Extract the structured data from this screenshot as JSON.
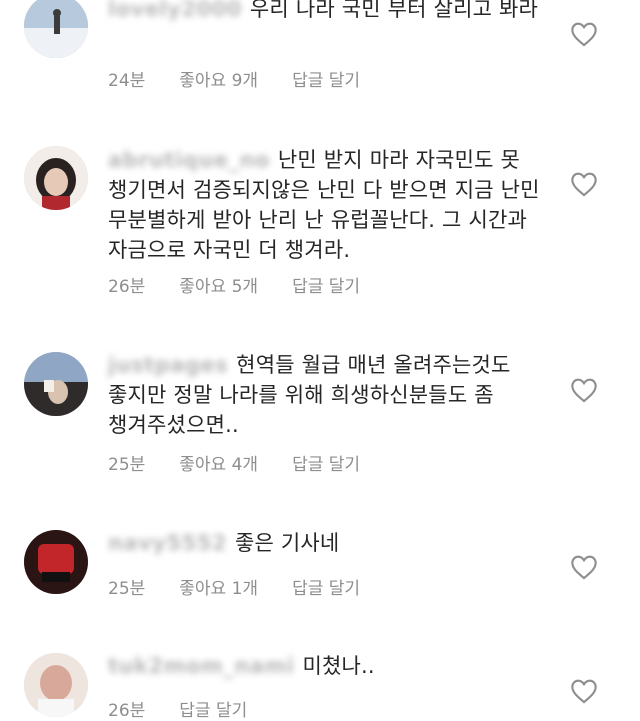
{
  "comments": [
    {
      "username": "lovely2000",
      "text": "우리 나라 국민 부터 살리고 봐라",
      "time": "24분",
      "likes": "좋아요 9개",
      "reply": "답글 달기",
      "avatar_color": "#9fb3c8"
    },
    {
      "username": "abrutique_no",
      "text": "난민 받지 마라 자국민도 못 챙기면서 검증되지않은 난민 다 받으면 지금 난민 무분별하게 받아 난리 난 유럽꼴난다. 그 시간과 자금으로 자국민 더 챙겨라.",
      "time": "26분",
      "likes": "좋아요 5개",
      "reply": "답글 달기",
      "avatar_color": "#e9e2dc"
    },
    {
      "username": "justpages",
      "text": "현역들 월급 매년 올려주는것도 좋지만 정말 나라를 위해 희생하신분들도 좀 챙겨주셨으면..",
      "time": "25분",
      "likes": "좋아요 4개",
      "reply": "답글 달기",
      "avatar_color": "#8fa3bd"
    },
    {
      "username": "navy5552",
      "text": "좋은 기사네",
      "time": "25분",
      "likes": "좋아요 1개",
      "reply": "답글 달기",
      "avatar_color": "#3a1b1b"
    },
    {
      "username": "tuk2mom_nami",
      "text": "미쳤나..",
      "time": "26분",
      "likes": "",
      "reply": "답글 달기",
      "avatar_color": "#e7d7cf"
    }
  ],
  "icons": {
    "like": "heart-outline-icon"
  },
  "colors": {
    "text": "#262626",
    "meta": "#8e8e8e",
    "heart_stroke": "#8e8e8e"
  }
}
